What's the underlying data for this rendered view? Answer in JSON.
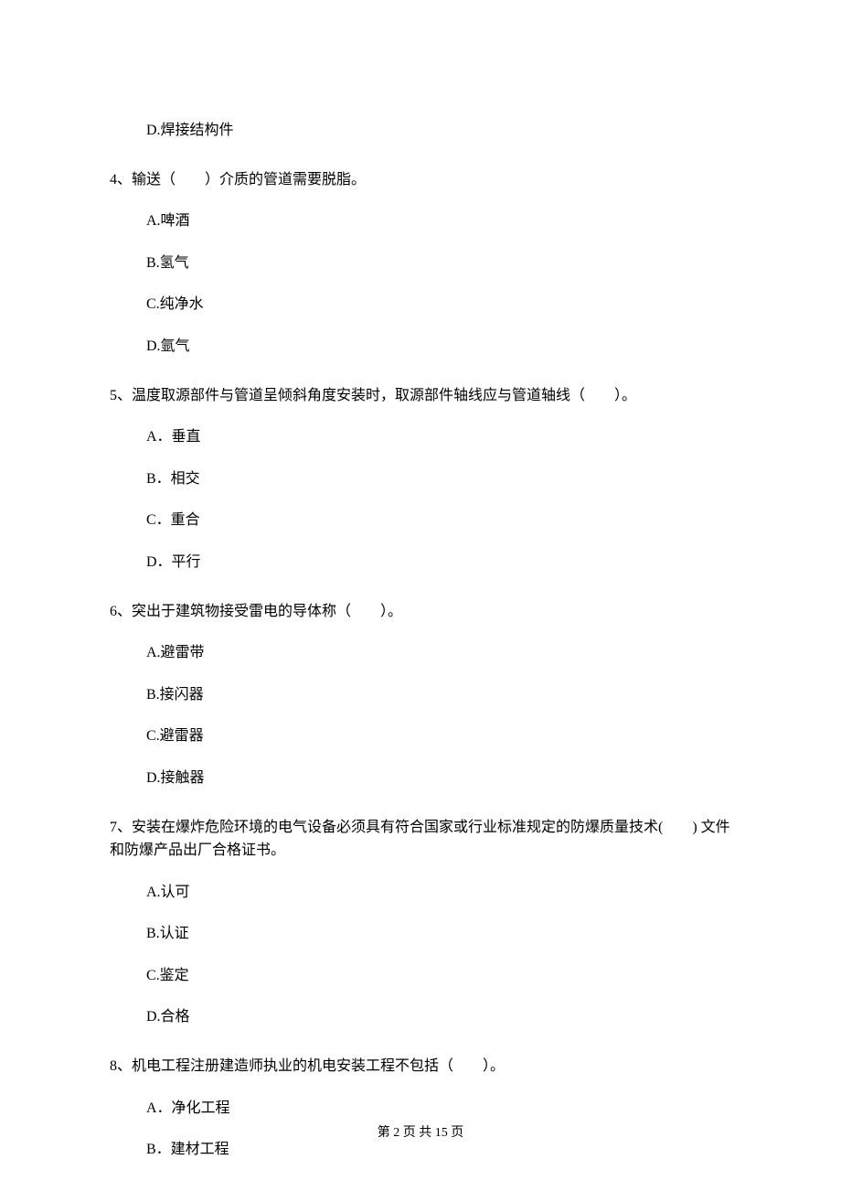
{
  "q3_option_d": "D.焊接结构件",
  "q4_text": "4、输送（　　）介质的管道需要脱脂。",
  "q4_a": "A.啤酒",
  "q4_b": "B.氢气",
  "q4_c": "C.纯净水",
  "q4_d": "D.氩气",
  "q5_text": "5、温度取源部件与管道呈倾斜角度安装时，取源部件轴线应与管道轴线（　　）。",
  "q5_a": "A．垂直",
  "q5_b": "B．相交",
  "q5_c": "C．重合",
  "q5_d": "D．平行",
  "q6_text": "6、突出于建筑物接受雷电的导体称（　　）。",
  "q6_a": "A.避雷带",
  "q6_b": "B.接闪器",
  "q6_c": "C.避雷器",
  "q6_d": "D.接触器",
  "q7_text": "7、安装在爆炸危险环境的电气设备必须具有符合国家或行业标准规定的防爆质量技术(　　) 文件和防爆产品出厂合格证书。",
  "q7_a": "A.认可",
  "q7_b": "B.认证",
  "q7_c": "C.鉴定",
  "q7_d": "D.合格",
  "q8_text": "8、机电工程注册建造师执业的机电安装工程不包括（　　）。",
  "q8_a": "A．净化工程",
  "q8_b": "B．建材工程",
  "footer": "第 2 页 共 15 页"
}
